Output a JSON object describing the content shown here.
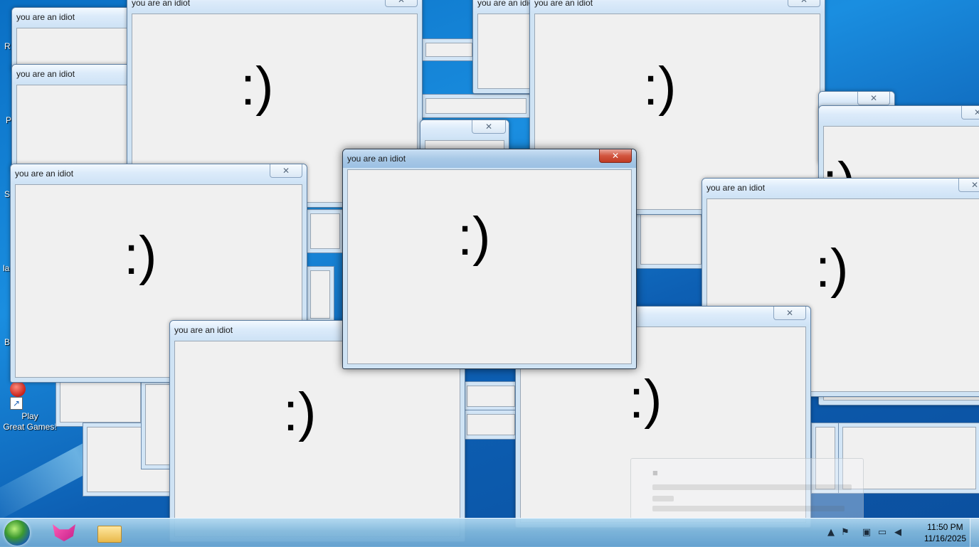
{
  "window_title": "you are an idiot",
  "window_content": ":)",
  "close_glyph": "✕",
  "desktop_icons": {
    "play_label": "Play\nGreat Games!",
    "partial_letters": [
      "R",
      "P",
      "S",
      "la",
      "B"
    ]
  },
  "taskbar": {
    "clock_time": "11:50 PM",
    "clock_date": "11/16/2025",
    "tray_icons": [
      "show-hidden-icons-arrow",
      "network-icon",
      "action-center-icon",
      "display-icon",
      "volume-muted-icon"
    ]
  },
  "colors": {
    "desktop_blue": "#0a6fc4",
    "window_client": "#f0f0f0",
    "active_close": "#c03a23"
  }
}
